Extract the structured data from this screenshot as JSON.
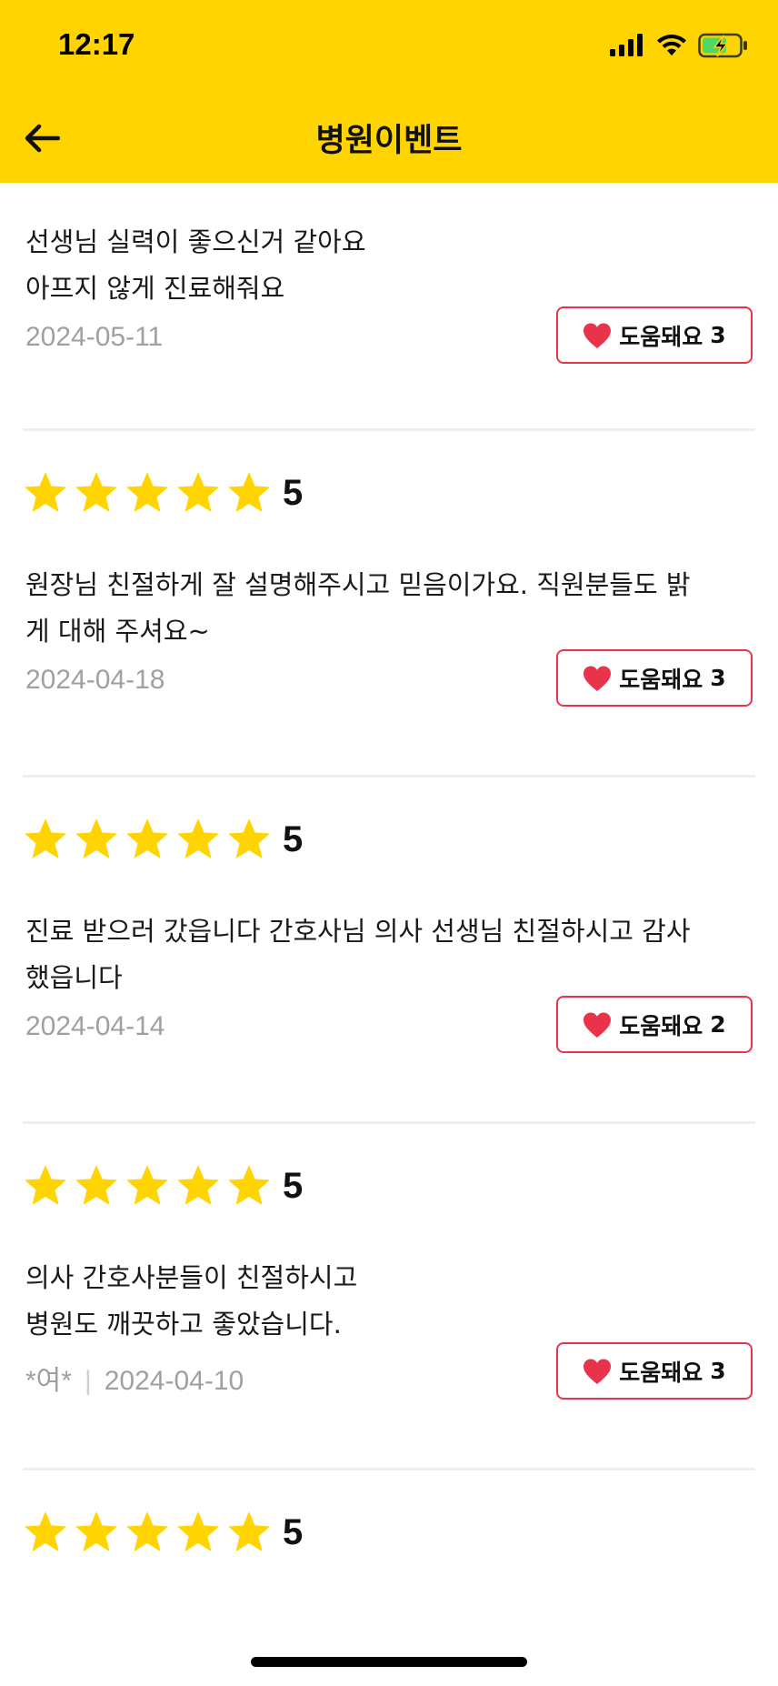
{
  "status_bar": {
    "time": "12:17"
  },
  "header": {
    "title": "병원이벤트"
  },
  "reviews": [
    {
      "rating": null,
      "text_lines": [
        "선생님 실력이 좋으신거 같아요",
        "아프지 않게 진료해줘요"
      ],
      "author": null,
      "date": "2024-05-11",
      "helpful_label": "도움돼요",
      "helpful_count": "3"
    },
    {
      "rating": "5",
      "text_lines": [
        "원장님 친절하게 잘 설명해주시고 믿음이가요. 직원분들도 밝",
        "게 대해 주셔요~"
      ],
      "author": null,
      "date": "2024-04-18",
      "helpful_label": "도움돼요",
      "helpful_count": "3"
    },
    {
      "rating": "5",
      "text_lines": [
        "진료 받으러 갔읍니다 간호사님 의사 선생님 친절하시고 감사",
        "했읍니다"
      ],
      "author": null,
      "date": "2024-04-14",
      "helpful_label": "도움돼요",
      "helpful_count": "2"
    },
    {
      "rating": "5",
      "text_lines": [
        "의사 간호사분들이 친절하시고",
        "병원도 깨끗하고 좋았습니다."
      ],
      "author": "*여*",
      "date": "2024-04-10",
      "helpful_label": "도움돼요",
      "helpful_count": "3"
    },
    {
      "rating": "5",
      "text_lines": [],
      "author": null,
      "date": null,
      "helpful_label": null,
      "helpful_count": null
    }
  ],
  "colors": {
    "accent": "#FFD400",
    "star": "#FFD400",
    "heart": "#E8334A",
    "date": "#a0a0a0"
  }
}
